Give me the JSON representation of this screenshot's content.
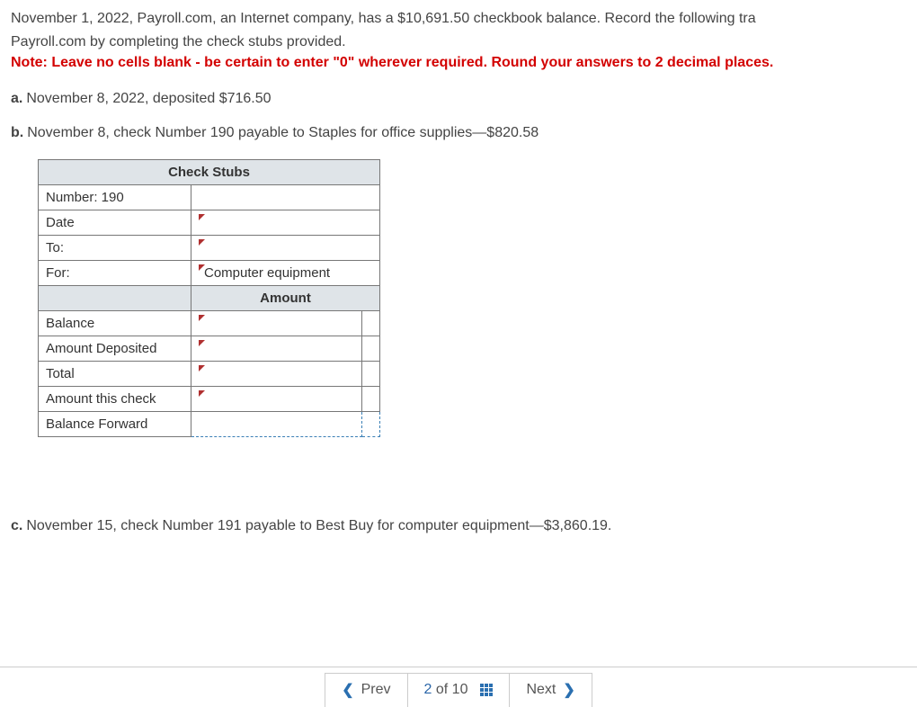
{
  "intro_line1": "November 1, 2022, Payroll.com, an Internet company, has a $10,691.50 checkbook balance. Record the following tra",
  "intro_line2": "Payroll.com by completing the check stubs provided.",
  "note": "Note: Leave no cells blank - be certain to enter \"0\" wherever required. Round your answers to 2 decimal places.",
  "items": {
    "a": {
      "label": "a.",
      "text": "November 8, 2022, deposited $716.50"
    },
    "b": {
      "label": "b.",
      "text": "November 8, check Number 190 payable to Staples for office supplies—$820.58"
    },
    "c": {
      "label": "c.",
      "text": "November 15, check Number 191 payable to Best Buy for computer equipment—$3,860.19."
    }
  },
  "stub": {
    "header": "Check Stubs",
    "rows": {
      "number_label": "Number: 190",
      "date_label": "Date",
      "date_value": "",
      "to_label": "To:",
      "to_value": "",
      "for_label": "For:",
      "for_value": "Computer equipment",
      "amount_header": "Amount",
      "balance_label": "Balance",
      "balance_value": "",
      "deposited_label": "Amount Deposited",
      "deposited_value": "",
      "total_label": "Total",
      "total_value": "",
      "thischeck_label": "Amount this check",
      "thischeck_value": "",
      "forward_label": "Balance Forward",
      "forward_value": ""
    }
  },
  "nav": {
    "prev": "Prev",
    "next": "Next",
    "page_current": "2",
    "page_of": "of",
    "page_total": "10"
  }
}
